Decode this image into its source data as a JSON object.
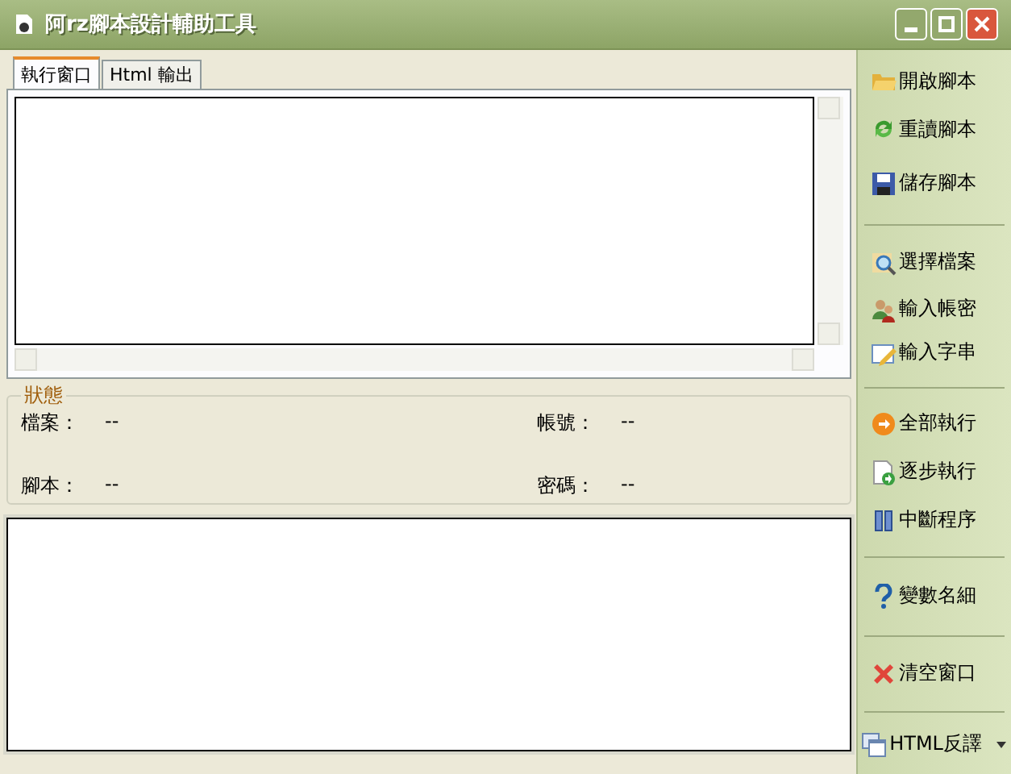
{
  "window": {
    "title": "阿rz腳本設計輔助工具"
  },
  "tabs": [
    {
      "label": "執行窗口",
      "selected": true
    },
    {
      "label": "Html 輸出",
      "selected": false
    }
  ],
  "status": {
    "title": "狀態",
    "fields": [
      {
        "label": "檔案：",
        "value": "--"
      },
      {
        "label": "帳號：",
        "value": "--"
      },
      {
        "label": "腳本：",
        "value": "--"
      },
      {
        "label": "密碼：",
        "value": "--"
      }
    ]
  },
  "toolbar": [
    {
      "kind": "button",
      "label": "開啟腳本"
    },
    {
      "kind": "button",
      "label": "重讀腳本"
    },
    {
      "kind": "button",
      "label": "儲存腳本"
    },
    {
      "kind": "separator"
    },
    {
      "kind": "button",
      "label": "選擇檔案"
    },
    {
      "kind": "button",
      "label": "輸入帳密"
    },
    {
      "kind": "button",
      "label": "輸入字串"
    },
    {
      "kind": "separator"
    },
    {
      "kind": "button",
      "label": "全部執行"
    },
    {
      "kind": "button",
      "label": "逐步執行"
    },
    {
      "kind": "button",
      "label": "中斷程序"
    },
    {
      "kind": "separator"
    },
    {
      "kind": "button",
      "label": "變數名細"
    },
    {
      "kind": "separator"
    },
    {
      "kind": "button",
      "label": "清空窗口"
    },
    {
      "kind": "separator"
    },
    {
      "kind": "button",
      "label": "HTML反譯",
      "dropdown": true
    }
  ]
}
